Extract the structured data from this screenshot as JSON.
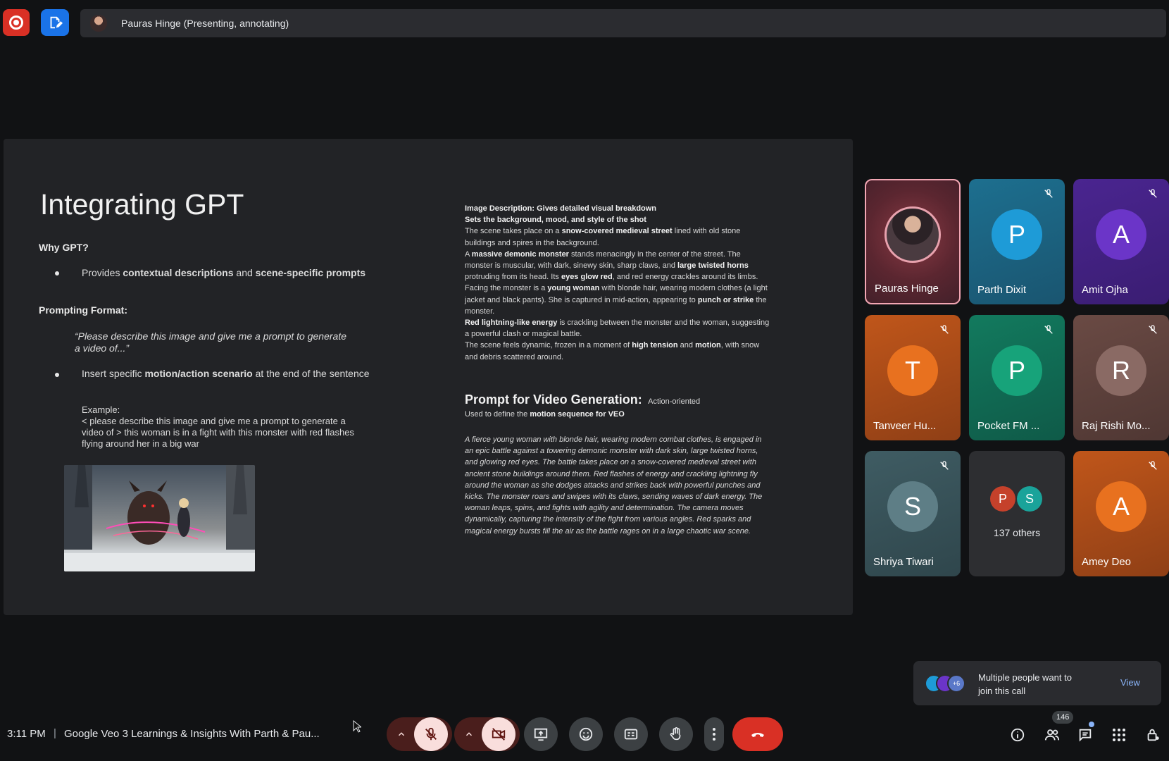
{
  "top_bar": {
    "presenter_label": "Pauras Hinge (Presenting, annotating)"
  },
  "slide": {
    "title": "Integrating GPT",
    "why_heading": "Why GPT?",
    "bullet1": {
      "pre": "Provides ",
      "b1": "contextual descriptions",
      "mid": " and ",
      "b2": "scene-specific prompts"
    },
    "prompting_heading": "Prompting Format:",
    "quote_line1": "“Please describe this image and give me a prompt to generate",
    "quote_line2": "a video of...”",
    "bullet2": {
      "pre": "Insert specific ",
      "b1": "motion/action scenario",
      "post": " at the end of the sentence"
    },
    "example_label": "Example:",
    "example_lines": [
      "< please describe this image and give me a prompt to generate a",
      "video of > this woman is in a fight with this monster with red flashes",
      "flying around her in a big war"
    ],
    "right": {
      "desc_line1": "Image Description: Gives detailed visual breakdown",
      "desc_line2": "Sets the background, mood, and style of the shot",
      "desc_p1_a": "The scene takes place on a ",
      "desc_p1_b": "snow-covered medieval street",
      "desc_p1_c": " lined with old stone",
      "desc_p1_d": "buildings and spires in the background.",
      "desc_p2_a": "A ",
      "desc_p2_b": "massive demonic monster",
      "desc_p2_c": " stands menacingly in the center of the street. The",
      "desc_p2_d": "monster is muscular, with dark, sinewy skin, sharp claws, and ",
      "desc_p2_e": "large twisted horns",
      "desc_p2_f": "protruding from its head. Its ",
      "desc_p2_g": "eyes glow red",
      "desc_p2_h": ", and red energy crackles around its limbs.",
      "desc_p2_i": "Facing the monster is a ",
      "desc_p2_j": "young woman",
      "desc_p2_k": " with blonde hair, wearing modern clothes (a light",
      "desc_p2_l": "jacket and black pants). She is captured in mid-action, appearing to ",
      "desc_p2_m": "punch or strike",
      "desc_p2_n": " the",
      "desc_p2_o": "monster.",
      "desc_p3_a": "Red lightning-like energy",
      "desc_p3_b": " is crackling between the monster and the woman, suggesting",
      "desc_p3_c": "a powerful clash or magical battle.",
      "desc_p4_a": "The scene feels dynamic, frozen in a moment of ",
      "desc_p4_b": "high tension",
      "desc_p4_c": " and ",
      "desc_p4_d": "motion",
      "desc_p4_e": ", with snow",
      "desc_p4_f": "and debris scattered around.",
      "prompt_heading": "Prompt for Video Generation:",
      "prompt_tag": "Action-oriented",
      "prompt_sub_a": "Used to define the ",
      "prompt_sub_b": "motion sequence for VEO",
      "prompt_lines": [
        "A fierce young woman with blonde hair, wearing modern combat clothes, is engaged in",
        "an epic battle against a towering demonic monster with dark skin, large twisted horns,",
        "and glowing red eyes. The battle takes place on a snow-covered medieval street with",
        "ancient stone buildings around them. Red flashes of energy and crackling lightning fly",
        "around the woman as she dodges attacks and strikes back with powerful punches and",
        "kicks. The monster roars and swipes with its claws, sending waves of dark energy. The",
        "woman leaps, spins, and fights with agility and determination. The camera moves",
        "dynamically, capturing the intensity of the fight from various angles. Red sparks and",
        "magical energy bursts fill the air as the battle rages on in a large chaotic war scene."
      ]
    }
  },
  "participants": [
    {
      "name": "Pauras Hinge"
    },
    {
      "name": "Parth Dixit",
      "initial": "P"
    },
    {
      "name": "Amit Ojha",
      "initial": "A"
    },
    {
      "name": "Tanveer Hu...",
      "initial": "T"
    },
    {
      "name": "Pocket FM ...",
      "initial": "P"
    },
    {
      "name": "Raj Rishi Mo...",
      "initial": "R"
    },
    {
      "name": "Shriya Tiwari",
      "initial": "S"
    },
    {
      "others_label": "137 others",
      "i1": "P",
      "i2": "S"
    },
    {
      "name": "Amey Deo",
      "initial": "A"
    }
  ],
  "notification": {
    "line1": "Multiple people want to",
    "line2": "join this call",
    "action": "View",
    "badge": "+6"
  },
  "bottom_bar": {
    "time": "3:11 PM",
    "separator": "|",
    "meeting_title": "Google Veo 3 Learnings & Insights With Parth & Pau...",
    "people_count": "146"
  },
  "colors": {
    "end_call": "#d93025",
    "accent_blue": "#1a73e8",
    "mic_off_bg": "#f9dedc"
  }
}
